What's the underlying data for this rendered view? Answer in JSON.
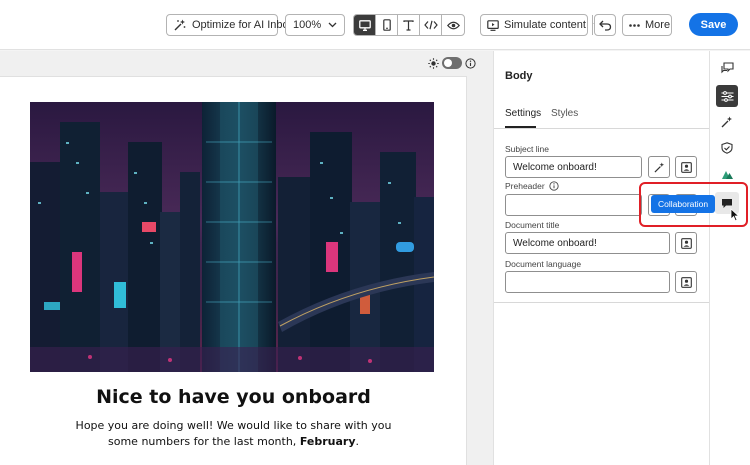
{
  "toolbar": {
    "ai_inbox_label": "Optimize for AI Inbox",
    "zoom_value": "100%",
    "simulate_label": "Simulate content",
    "more_label": "More",
    "save_label": "Save"
  },
  "email": {
    "headline": "Nice to have you onboard",
    "body_text": "Hope you are doing well! We would like to share with you some numbers for the last month, ",
    "body_emphasis": "February",
    "body_end": "."
  },
  "panel": {
    "title": "Body",
    "tabs": [
      "Settings",
      "Styles"
    ],
    "active_tab": "Settings",
    "fields": {
      "subject_label": "Subject line",
      "subject_value": "Welcome onboard!",
      "preheader_label": "Preheader",
      "preheader_value": "",
      "doc_title_label": "Document title",
      "doc_title_value": "Welcome onboard!",
      "doc_lang_label": "Document language",
      "doc_lang_value": ""
    }
  },
  "tooltip": {
    "text": "Collaboration"
  },
  "colors": {
    "accent": "#1473e6",
    "highlight": "#e01f26",
    "active_icon_bg": "#3b3b3b"
  },
  "icons": {
    "ai_inbox": "sparkle-icon",
    "desktop": "desktop-icon",
    "mobile": "mobile-icon",
    "text": "text-icon",
    "code": "code-icon",
    "preview": "eye-icon",
    "simulate": "simulate-icon",
    "undo": "undo-icon",
    "more": "ellipsis-icon",
    "collaboration": "comment-icon"
  }
}
